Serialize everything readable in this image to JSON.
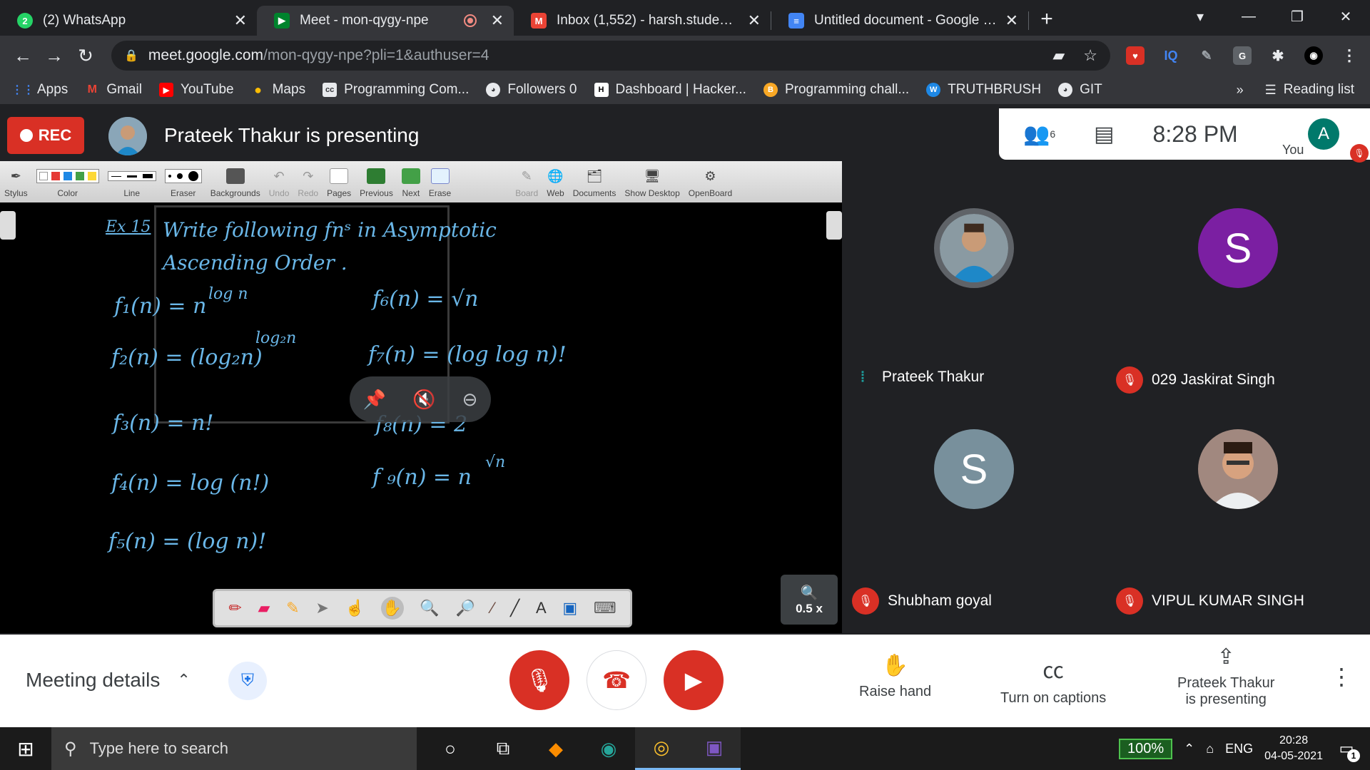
{
  "browser": {
    "tabs": [
      {
        "title": "(2) WhatsApp",
        "icon": "whatsapp-icon",
        "color": "#25d366",
        "active": false
      },
      {
        "title": "Meet - mon-qygy-npe",
        "icon": "meet-icon",
        "color": "#00832d",
        "active": true
      },
      {
        "title": "Inbox (1,552) - harsh.student99@",
        "icon": "gmail-icon",
        "color": "#ea4335",
        "active": false
      },
      {
        "title": "Untitled document - Google Doc",
        "icon": "docs-icon",
        "color": "#4285f4",
        "active": false
      }
    ],
    "url_host": "meet.google.com",
    "url_path": "/mon-qygy-npe?pli=1&authuser=4",
    "bookmarks": [
      {
        "label": "Apps",
        "icon": "apps-grid-icon"
      },
      {
        "label": "Gmail",
        "icon": "gmail-icon"
      },
      {
        "label": "YouTube",
        "icon": "youtube-icon"
      },
      {
        "label": "Maps",
        "icon": "maps-pin-icon"
      },
      {
        "label": "Programming Com...",
        "icon": "cc-icon"
      },
      {
        "label": "Followers 0",
        "icon": "github-icon"
      },
      {
        "label": "Dashboard | Hacker...",
        "icon": "hackerrank-icon"
      },
      {
        "label": "Programming chall...",
        "icon": "hackerearth-icon"
      },
      {
        "label": "TRUTHBRUSH",
        "icon": "wordpress-icon"
      },
      {
        "label": "GIT",
        "icon": "github-icon"
      }
    ],
    "reading_list": "Reading list"
  },
  "meet": {
    "rec_label": "REC",
    "presenting_title": "Prateek Thakur is presenting",
    "participant_count": "6",
    "time": "8:28 PM",
    "you_label": "You",
    "self_initial": "A"
  },
  "openboard": {
    "tools": [
      {
        "label": "Stylus",
        "icon": "stylus-icon"
      },
      {
        "label": "Color",
        "icon": "color-swatches"
      },
      {
        "label": "Line",
        "icon": "line-width"
      },
      {
        "label": "Eraser",
        "icon": "eraser-size"
      },
      {
        "label": "Backgrounds",
        "icon": "backgrounds-icon"
      },
      {
        "label": "Undo",
        "icon": "undo-icon"
      },
      {
        "label": "Redo",
        "icon": "redo-icon"
      },
      {
        "label": "Pages",
        "icon": "pages-icon"
      },
      {
        "label": "Previous",
        "icon": "previous-icon"
      },
      {
        "label": "Next",
        "icon": "next-icon"
      },
      {
        "label": "Erase",
        "icon": "erase-icon"
      },
      {
        "label": "Board",
        "icon": "board-icon"
      },
      {
        "label": "Web",
        "icon": "web-globe-icon"
      },
      {
        "label": "Documents",
        "icon": "documents-icon"
      },
      {
        "label": "Show Desktop",
        "icon": "desktop-icon"
      },
      {
        "label": "OpenBoard",
        "icon": "openboard-gear-icon"
      }
    ],
    "zoom": "0.5 x",
    "notes": {
      "heading_label": "Ex 15",
      "heading_line1": "Write following fnˢ in Asymptotic",
      "heading_line2": "Ascending Order .",
      "f1": "f₁(n) = n",
      "f1_exp": "log n",
      "f2": "f₂(n) = (log₂n)",
      "f2_exp": "log₂n",
      "f3": "f₃(n) = n!",
      "f4": "f₄(n) = log (n!)",
      "f5": "f₅(n) = (log n)!",
      "f6": "f₆(n) = √n",
      "f7": "f₇(n) = (log log n)!",
      "f8": "f₈(n) = 2",
      "f9": "f ₉(n) = n",
      "f9_exp": "√n"
    }
  },
  "participants": [
    {
      "name": "Prateek Thakur",
      "initial": "",
      "avatar_color": "#5b7c8f",
      "muted": false
    },
    {
      "name": "029 Jaskirat Singh",
      "initial": "S",
      "avatar_color": "#7b1fa2",
      "muted": true
    },
    {
      "name": "Shubham goyal",
      "initial": "S",
      "avatar_color": "#78909c",
      "muted": true
    },
    {
      "name": "VIPUL KUMAR SINGH",
      "initial": "",
      "avatar_color": "#a1887f",
      "muted": true
    }
  ],
  "controls": {
    "meeting_details": "Meeting details",
    "raise_hand": "Raise hand",
    "captions": "Turn on captions",
    "presenting_line1": "Prateek Thakur",
    "presenting_line2": "is presenting"
  },
  "taskbar": {
    "search_placeholder": "Type here to search",
    "battery": "100%",
    "language": "ENG",
    "time": "20:28",
    "date": "04-05-2021",
    "notifications": "1"
  }
}
